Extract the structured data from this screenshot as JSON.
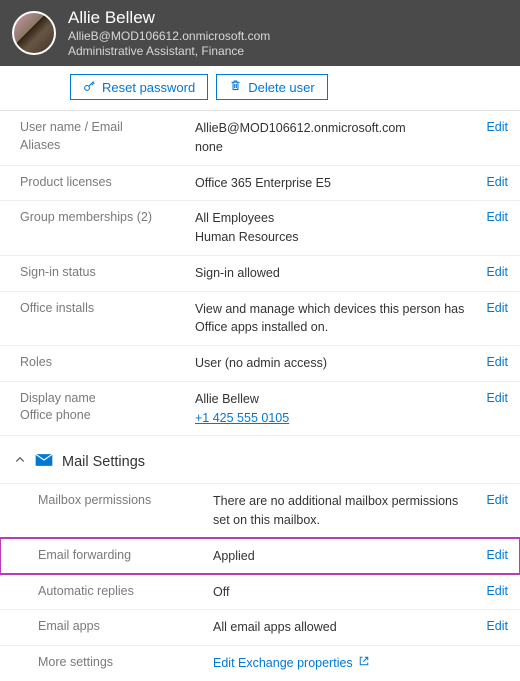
{
  "header": {
    "name": "Allie Bellew",
    "email": "AllieB@MOD106612.onmicrosoft.com",
    "title": "Administrative Assistant, Finance"
  },
  "actions": {
    "reset": "Reset password",
    "delete": "Delete user"
  },
  "edit_label": "Edit",
  "rows": {
    "username_label": "User name / Email",
    "username_value": "AllieB@MOD106612.onmicrosoft.com",
    "aliases_label": "Aliases",
    "aliases_value": "none",
    "licenses_label": "Product licenses",
    "licenses_value": "Office 365 Enterprise E5",
    "groups_label": "Group memberships (2)",
    "groups_value1": "All Employees",
    "groups_value2": "Human Resources",
    "signin_label": "Sign-in status",
    "signin_value": "Sign-in allowed",
    "installs_label": "Office installs",
    "installs_value": "View and manage which devices this person has Office apps installed on.",
    "roles_label": "Roles",
    "roles_value": "User (no admin access)",
    "display_label1": "Display name",
    "display_label2": "Office phone",
    "display_value1": "Allie Bellew",
    "display_value2": "+1 425 555 0105"
  },
  "mail_section": {
    "title": "Mail Settings",
    "perm_label": "Mailbox permissions",
    "perm_value": "There are no additional mailbox permissions set on this mailbox.",
    "fwd_label": "Email forwarding",
    "fwd_value": "Applied",
    "auto_label": "Automatic replies",
    "auto_value": "Off",
    "apps_label": "Email apps",
    "apps_value": "All email apps allowed",
    "more_label": "More settings",
    "more_link": "Edit Exchange properties"
  }
}
